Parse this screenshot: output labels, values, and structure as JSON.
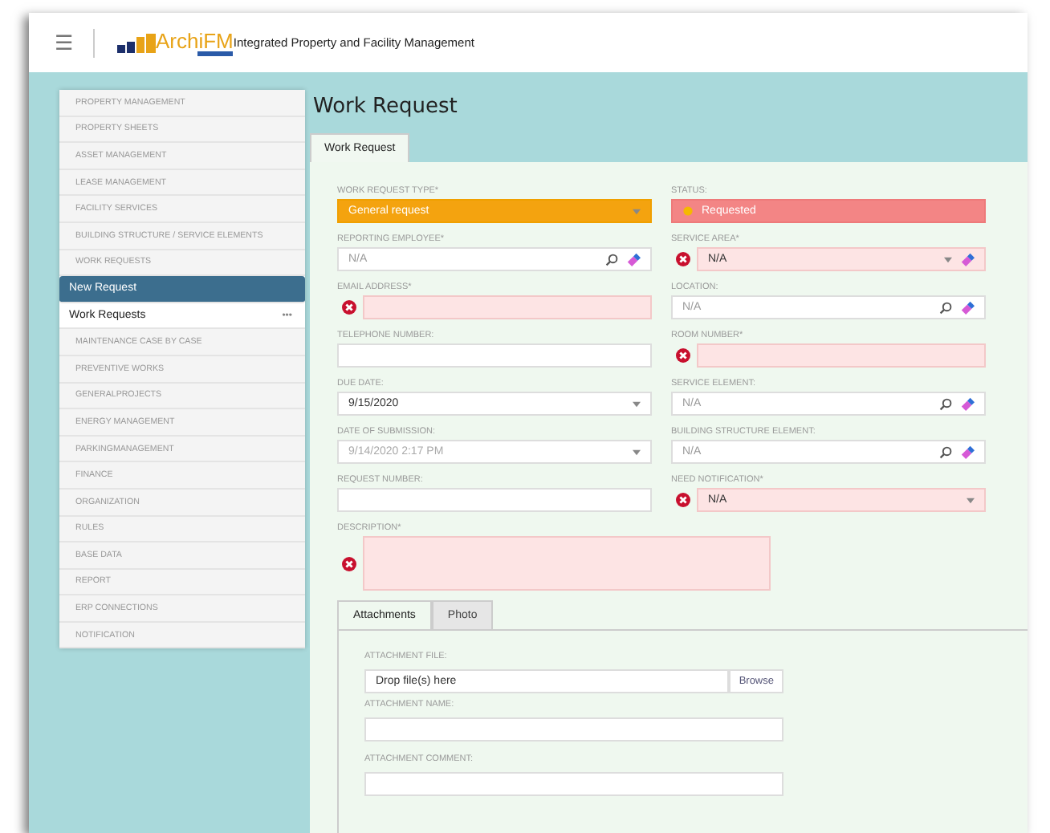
{
  "header": {
    "menu_icon": "☰",
    "logo": "ArchiFM",
    "app_title": "Integrated Property and Facility Management"
  },
  "sidebar": {
    "items": [
      {
        "label": "PROPERTY MANAGEMENT",
        "kind": "section",
        "selected": false
      },
      {
        "label": "PROPERTY SHEETS",
        "kind": "section",
        "selected": false
      },
      {
        "label": "ASSET MANAGEMENT",
        "kind": "section",
        "selected": false
      },
      {
        "label": "LEASE MANAGEMENT",
        "kind": "section",
        "selected": false
      },
      {
        "label": "FACILITY SERVICES",
        "kind": "section",
        "selected": false
      },
      {
        "label": "BUILDING STRUCTURE / SERVICE ELEMENTS",
        "kind": "section",
        "selected": false
      },
      {
        "label": "WORK REQUESTS",
        "kind": "section",
        "selected": false
      },
      {
        "label": "New Request",
        "kind": "sub",
        "selected": true
      },
      {
        "label": "Work Requests",
        "kind": "sub",
        "selected": false,
        "more": "•••"
      },
      {
        "label": "MAINTENANCE CASE BY CASE",
        "kind": "section",
        "selected": false
      },
      {
        "label": "PREVENTIVE WORKS",
        "kind": "section",
        "selected": false
      },
      {
        "label": "GENERALPROJECTS",
        "kind": "section",
        "selected": false
      },
      {
        "label": "ENERGY MANAGEMENT",
        "kind": "section",
        "selected": false
      },
      {
        "label": "PARKINGMANAGEMENT",
        "kind": "section",
        "selected": false
      },
      {
        "label": "FINANCE",
        "kind": "section",
        "selected": false
      },
      {
        "label": "ORGANIZATION",
        "kind": "section",
        "selected": false
      },
      {
        "label": "RULES",
        "kind": "section",
        "selected": false
      },
      {
        "label": "BASE DATA",
        "kind": "section",
        "selected": false
      },
      {
        "label": "REPORT",
        "kind": "section",
        "selected": false
      },
      {
        "label": "ERP CONNECTIONS",
        "kind": "section",
        "selected": false
      },
      {
        "label": "NOTIFICATION",
        "kind": "section",
        "selected": false
      }
    ]
  },
  "page_title": "Work Request",
  "tabs": [
    {
      "label": "Work Request",
      "selected": true
    }
  ],
  "form": {
    "left_column": [
      {
        "label": "WORK REQUEST TYPE*",
        "kind": "choice",
        "value": "General request",
        "error": false
      },
      {
        "label": "REPORTING EMPLOYEE*",
        "kind": "lookup",
        "placeholder": "N/A",
        "error": false
      },
      {
        "label": "EMAIL ADDRESS*",
        "kind": "text",
        "error": true
      },
      {
        "label": "TELEPHONE NUMBER:",
        "kind": "text",
        "error": false
      },
      {
        "label": "DUE DATE:",
        "kind": "dropdown",
        "value": "9/15/2020",
        "error": false
      },
      {
        "label": "DATE OF SUBMISSION:",
        "kind": "dropdown",
        "value": "9/14/2020 2:17 PM",
        "disabled": true,
        "error": false
      },
      {
        "label": "REQUEST NUMBER:",
        "kind": "text",
        "error": false
      }
    ],
    "right_column": [
      {
        "label": "STATUS:",
        "kind": "status",
        "value": "Requested",
        "error": false
      },
      {
        "label": "SERVICE AREA*",
        "kind": "dropdown-clear",
        "value": "N/A",
        "error": true
      },
      {
        "label": "LOCATION:",
        "kind": "lookup",
        "placeholder": "N/A",
        "error": false
      },
      {
        "label": "ROOM NUMBER*",
        "kind": "text",
        "error": true
      },
      {
        "label": "SERVICE ELEMENT:",
        "kind": "lookup",
        "placeholder": "N/A",
        "error": false
      },
      {
        "label": "BUILDING STRUCTURE ELEMENT:",
        "kind": "lookup",
        "placeholder": "N/A",
        "error": false
      },
      {
        "label": "NEED NOTIFICATION*",
        "kind": "dropdown",
        "value": "N/A",
        "error": true
      }
    ],
    "description": {
      "label": "DESCRIPTION*",
      "error": true
    }
  },
  "attachment_tabs": [
    {
      "label": "Attachments",
      "selected": true
    },
    {
      "label": "Photo",
      "selected": false
    }
  ],
  "attachment": {
    "file_label": "ATTACHMENT FILE:",
    "file_placeholder": "Drop file(s) here",
    "browse": "Browse",
    "name_label": "ATTACHMENT NAME:",
    "comment_label": "ATTACHMENT COMMENT:"
  }
}
